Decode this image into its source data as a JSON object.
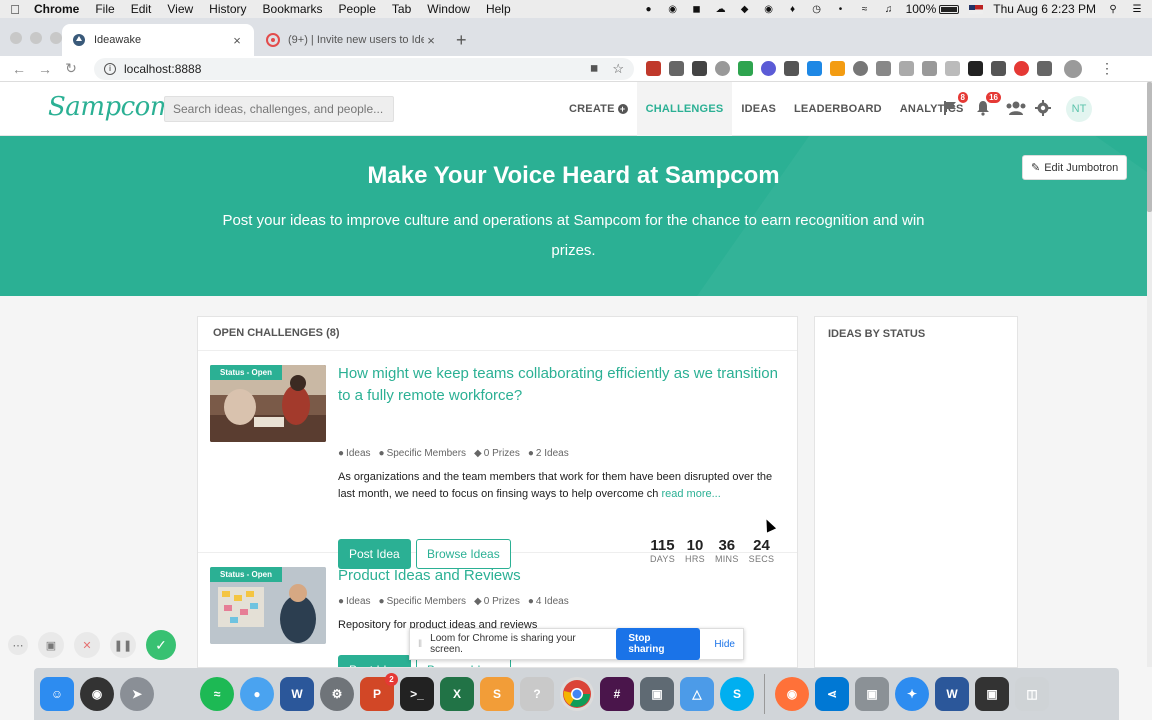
{
  "menubar": {
    "app": "Chrome",
    "items": [
      "File",
      "Edit",
      "View",
      "History",
      "Bookmarks",
      "People",
      "Tab",
      "Window",
      "Help"
    ],
    "battery": "100%",
    "clock": "Thu Aug 6  2:23 PM"
  },
  "browser": {
    "tabs": [
      {
        "title": "Ideawake",
        "active": true
      },
      {
        "title": "(9+) | Invite new users to Ideaw",
        "active": false
      }
    ],
    "url": "localhost:8888"
  },
  "site": {
    "logo": "Sampcom",
    "search_placeholder": "Search ideas, challenges, and people...",
    "nav": {
      "create": "CREATE",
      "challenges": "CHALLENGES",
      "ideas": "IDEAS",
      "leaderboard": "LEADERBOARD",
      "analytics": "ANALYTICS"
    },
    "flag_badge": "8",
    "bell_badge": "16",
    "avatar_initials": "NT"
  },
  "jumbotron": {
    "title": "Make Your Voice Heard at Sampcom",
    "text": "Post your ideas to improve culture and operations at Sampcom for the chance to earn recognition and win prizes.",
    "edit_label": "Edit Jumbotron"
  },
  "open_challenges": {
    "heading": "OPEN CHALLENGES (8)",
    "items": [
      {
        "status": "Status - Open",
        "title": "How might we keep teams collaborating efficiently as we transition to a fully remote workforce?",
        "meta": [
          "Ideas",
          "Specific Members",
          "0 Prizes",
          "2 Ideas"
        ],
        "description": "As organizations and the team members that work for them have been disrupted over the last month, we need to focus on finsing ways to help overcome ch",
        "read_more": "read more...",
        "post_label": "Post Idea",
        "browse_label": "Browse Ideas",
        "countdown": [
          {
            "value": "115",
            "label": "DAYS"
          },
          {
            "value": "10",
            "label": "HRS"
          },
          {
            "value": "36",
            "label": "MINS"
          },
          {
            "value": "24",
            "label": "SECS"
          }
        ]
      },
      {
        "status": "Status - Open",
        "title": "Product Ideas and Reviews",
        "meta": [
          "Ideas",
          "Specific Members",
          "0 Prizes",
          "4 Ideas"
        ],
        "description": "Repository for product ideas and reviews",
        "post_label": "Post Idea",
        "browse_label": "Browse Ideas"
      }
    ]
  },
  "ideas_by_status": {
    "heading": "IDEAS BY STATUS"
  },
  "loom": {
    "message": "Loom for Chrome is sharing your screen.",
    "stop_label": "Stop sharing",
    "hide_label": "Hide"
  },
  "dock": {
    "powerpoint_badge": "2"
  },
  "colors": {
    "brand": "#2bb094",
    "badge": "#e53935",
    "loom_blue": "#1a73e8"
  }
}
